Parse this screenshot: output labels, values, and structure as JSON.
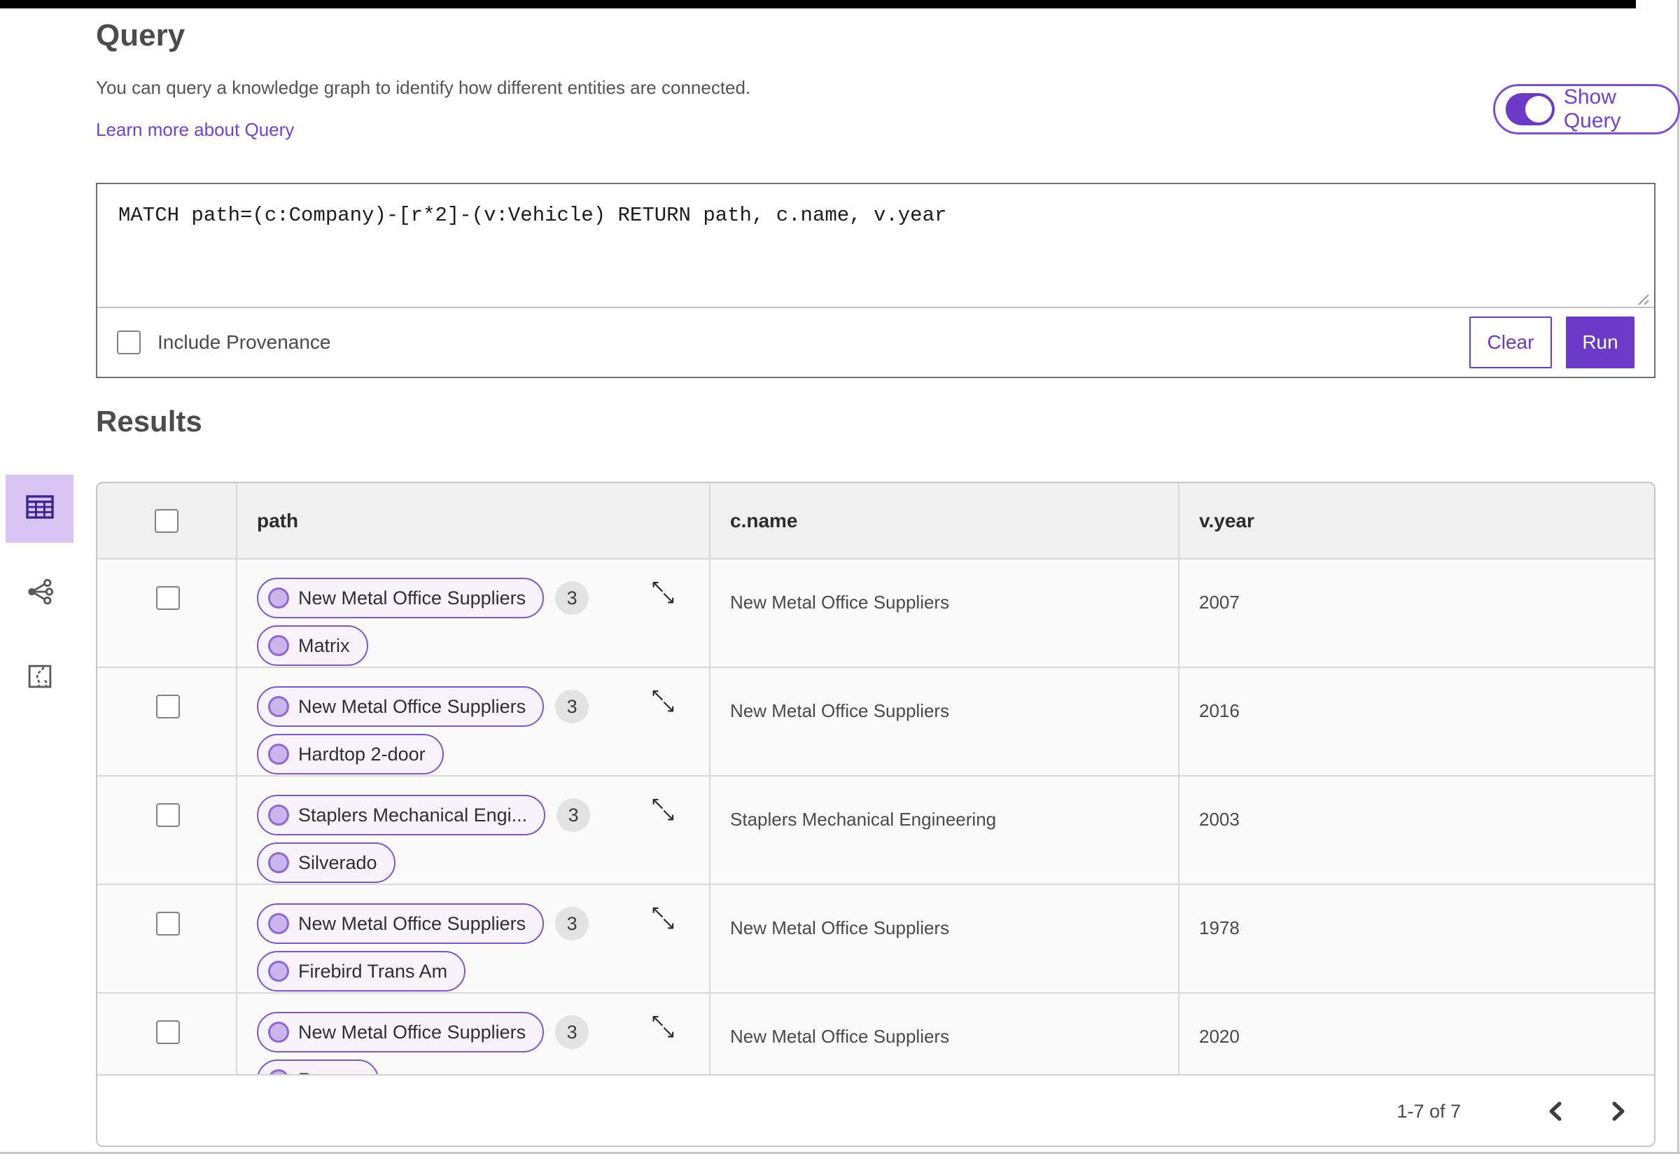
{
  "header": {
    "title": "Query",
    "description": "You can query a knowledge graph to identify how different entities are connected.",
    "learn_more_label": "Learn more about Query",
    "show_query_label": "Show Query",
    "show_query_on": true
  },
  "query_panel": {
    "query_text": "MATCH path=(c:Company)-[r*2]-(v:Vehicle) RETURN path, c.name, v.year",
    "include_provenance_label": "Include Provenance",
    "include_provenance_checked": false,
    "clear_label": "Clear",
    "run_label": "Run"
  },
  "results": {
    "heading": "Results",
    "views": [
      {
        "name": "table-view",
        "selected": true
      },
      {
        "name": "network-view",
        "selected": false
      },
      {
        "name": "route-map-view",
        "selected": false
      }
    ],
    "columns": [
      "path",
      "c.name",
      "v.year"
    ],
    "rows": [
      {
        "start_node": "New Metal Office Suppliers",
        "edge_count": "3",
        "end_node": "Matrix",
        "c_name": "New Metal Office Suppliers",
        "v_year": "2007"
      },
      {
        "start_node": "New Metal Office Suppliers",
        "edge_count": "3",
        "end_node": "Hardtop 2-door",
        "c_name": "New Metal Office Suppliers",
        "v_year": "2016"
      },
      {
        "start_node": "Staplers Mechanical Engi...",
        "edge_count": "3",
        "end_node": "Silverado",
        "c_name": "Staplers Mechanical Engineering",
        "v_year": "2003"
      },
      {
        "start_node": "New Metal Office Suppliers",
        "edge_count": "3",
        "end_node": "Firebird Trans Am",
        "c_name": "New Metal Office Suppliers",
        "v_year": "1978"
      },
      {
        "start_node": "New Metal Office Suppliers",
        "edge_count": "3",
        "end_node": "Ranger",
        "c_name": "New Metal Office Suppliers",
        "v_year": "2020"
      }
    ],
    "pagination": {
      "range_label": "1-7 of 7"
    }
  },
  "colors": {
    "primary_purple": "#6b3ac9",
    "link_purple": "#7140d8",
    "pill_border": "#7e57cf",
    "pill_fill": "#f6f3fc",
    "node_dot_fill": "#cab5ec",
    "selected_view_bg": "#d7c4f2",
    "badge_bg": "#e3e3e3",
    "header_row_bg": "#f0f0f0"
  }
}
